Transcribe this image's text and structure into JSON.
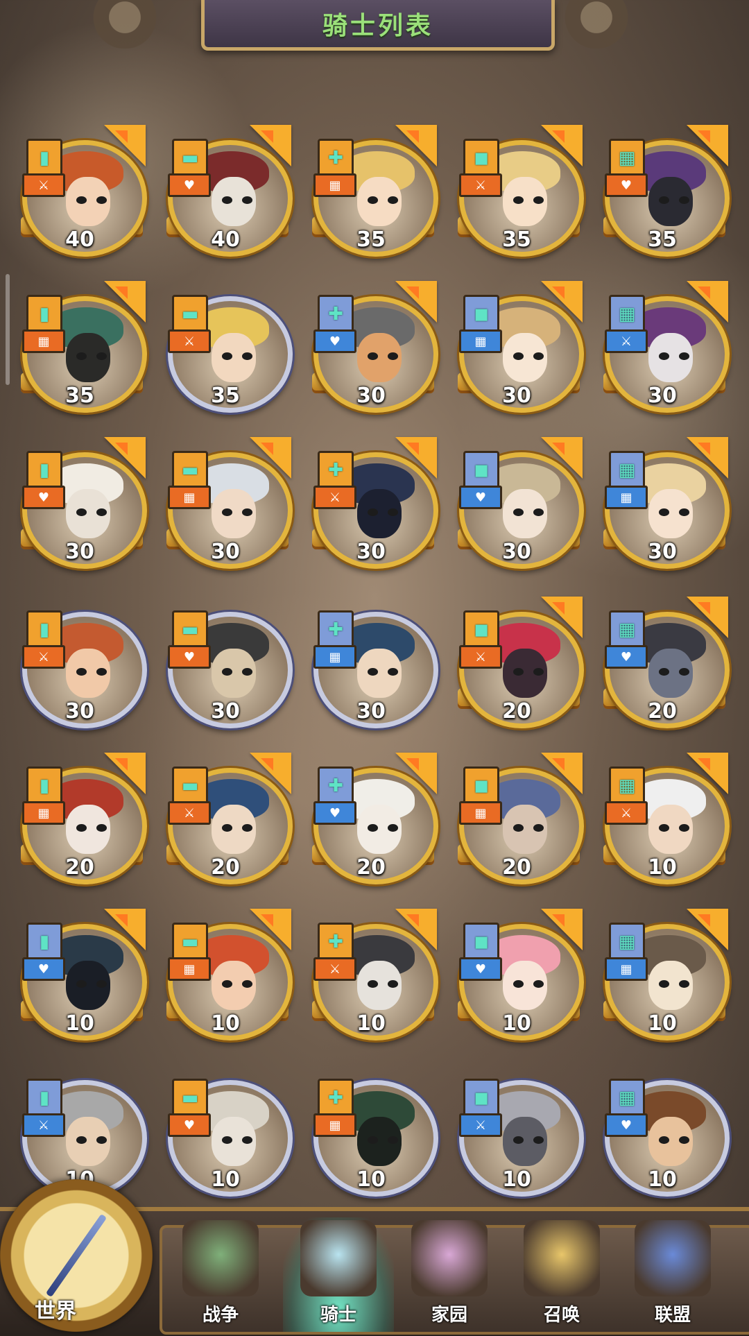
{
  "header": {
    "title": "骑士列表"
  },
  "colors": {
    "gold_frame": "#e3b53d",
    "silver_frame": "#c7cbe0",
    "badge_orange": "#e96b24",
    "badge_blue": "#3f86d9",
    "title_green": "#9be07a"
  },
  "knights": [
    {
      "level": "40",
      "frame": "gold",
      "role": "orange",
      "hair": "#c85a2a",
      "skin": "#f3d2b6"
    },
    {
      "level": "40",
      "frame": "gold",
      "role": "orange",
      "hair": "#7b2b2b",
      "skin": "#e8e2d8"
    },
    {
      "level": "35",
      "frame": "gold",
      "role": "orange",
      "hair": "#e6c26a",
      "skin": "#f6dcc3"
    },
    {
      "level": "35",
      "frame": "gold",
      "role": "orange",
      "hair": "#e8cc86",
      "skin": "#f7e0c8"
    },
    {
      "level": "35",
      "frame": "gold",
      "role": "orange",
      "hair": "#5a3a7a",
      "skin": "#2a2a32"
    },
    {
      "level": "35",
      "frame": "gold",
      "role": "orange",
      "hair": "#3a7060",
      "skin": "#2a2a28"
    },
    {
      "level": "35",
      "frame": "silver",
      "role": "orange",
      "hair": "#e6c45a",
      "skin": "#f2d8bf"
    },
    {
      "level": "30",
      "frame": "gold",
      "role": "blue",
      "hair": "#6a6a6a",
      "skin": "#e1a26a"
    },
    {
      "level": "30",
      "frame": "gold",
      "role": "blue",
      "hair": "#d6b27a",
      "skin": "#f7e6d4"
    },
    {
      "level": "30",
      "frame": "gold",
      "role": "blue",
      "hair": "#6a3a7a",
      "skin": "#e6e2e4"
    },
    {
      "level": "30",
      "frame": "gold",
      "role": "orange",
      "hair": "#f1ece3",
      "skin": "#e9e1d6"
    },
    {
      "level": "30",
      "frame": "gold",
      "role": "orange",
      "hair": "#d9dee4",
      "skin": "#f0dac6"
    },
    {
      "level": "30",
      "frame": "gold",
      "role": "orange",
      "hair": "#2a3450",
      "skin": "#1c2030"
    },
    {
      "level": "30",
      "frame": "gold",
      "role": "blue",
      "hair": "#c9b896",
      "skin": "#f2e3d4"
    },
    {
      "level": "30",
      "frame": "gold",
      "role": "blue",
      "hair": "#ead2a0",
      "skin": "#f6e2cf"
    },
    {
      "level": "30",
      "frame": "silver",
      "role": "orange",
      "hair": "#c45a30",
      "skin": "#f1c9a8"
    },
    {
      "level": "30",
      "frame": "silver",
      "role": "orange",
      "hair": "#3a3a3a",
      "skin": "#d9c7aa"
    },
    {
      "level": "30",
      "frame": "silver",
      "role": "blue",
      "hair": "#2d4a6a",
      "skin": "#eed7bf"
    },
    {
      "level": "20",
      "frame": "gold",
      "role": "orange",
      "hair": "#c8324a",
      "skin": "#3a2a34"
    },
    {
      "level": "20",
      "frame": "gold",
      "role": "blue",
      "hair": "#3a3a42",
      "skin": "#6c7284"
    },
    {
      "level": "20",
      "frame": "gold",
      "role": "orange",
      "hair": "#b23a2a",
      "skin": "#f0e6de"
    },
    {
      "level": "20",
      "frame": "gold",
      "role": "orange",
      "hair": "#2f4f7a",
      "skin": "#eed9c4"
    },
    {
      "level": "20",
      "frame": "gold",
      "role": "blue",
      "hair": "#f0eee8",
      "skin": "#f2ece4"
    },
    {
      "level": "20",
      "frame": "gold",
      "role": "orange",
      "hair": "#5a6a9a",
      "skin": "#d8c4b2"
    },
    {
      "level": "10",
      "frame": "gold",
      "role": "orange",
      "hair": "#efefef",
      "skin": "#f0d8c2"
    },
    {
      "level": "10",
      "frame": "gold",
      "role": "blue",
      "hair": "#2a3a48",
      "skin": "#1a1e26"
    },
    {
      "level": "10",
      "frame": "gold",
      "role": "orange",
      "hair": "#d2512e",
      "skin": "#f3cdb0"
    },
    {
      "level": "10",
      "frame": "gold",
      "role": "orange",
      "hair": "#3a3a3e",
      "skin": "#e6e2dc"
    },
    {
      "level": "10",
      "frame": "gold",
      "role": "blue",
      "hair": "#f0a0ae",
      "skin": "#f8e4d8"
    },
    {
      "level": "10",
      "frame": "gold",
      "role": "blue",
      "hair": "#6a5a4a",
      "skin": "#f2e4cf"
    },
    {
      "level": "10",
      "frame": "silver",
      "role": "blue",
      "hair": "#a8a8a8",
      "skin": "#e8cfb4"
    },
    {
      "level": "10",
      "frame": "silver",
      "role": "orange",
      "hair": "#d8d2c6",
      "skin": "#e9e2d8"
    },
    {
      "level": "10",
      "frame": "silver",
      "role": "orange",
      "hair": "#2e4a38",
      "skin": "#1c221e"
    },
    {
      "level": "10",
      "frame": "silver",
      "role": "blue",
      "hair": "#a8a8b0",
      "skin": "#5c5c64"
    },
    {
      "level": "10",
      "frame": "silver",
      "role": "blue",
      "hair": "#7a4a2a",
      "skin": "#e8c29c"
    }
  ],
  "bottom_nav": {
    "world": "世界",
    "items": [
      {
        "label": "战争",
        "icon": "map-icon",
        "active": false
      },
      {
        "label": "骑士",
        "icon": "knight-wizard-icon",
        "active": true
      },
      {
        "label": "家园",
        "icon": "gear-home-icon",
        "active": false
      },
      {
        "label": "召唤",
        "icon": "summon-altar-icon",
        "active": false
      },
      {
        "label": "联盟",
        "icon": "alliance-shield-icon",
        "active": false
      }
    ]
  }
}
